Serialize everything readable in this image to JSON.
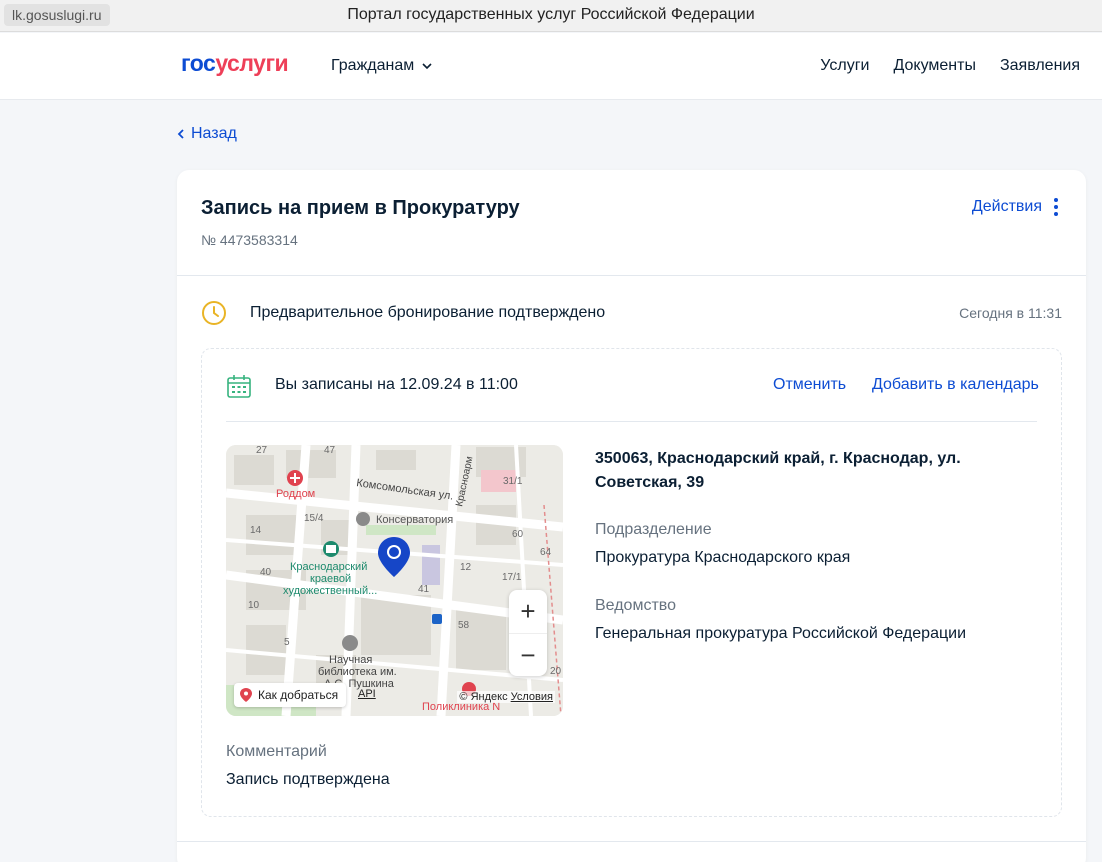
{
  "browser": {
    "url": "lk.gosuslugi.ru",
    "title": "Портал государственных услуг Российской Федерации"
  },
  "header": {
    "logo_part1": "гос",
    "logo_part2": "услуги",
    "citizens_label": "Гражданам",
    "nav": [
      "Услуги",
      "Документы",
      "Заявления"
    ]
  },
  "back_label": "Назад",
  "card": {
    "title": "Запись на прием в Прокуратуру",
    "number": "№ 4473583314",
    "actions_label": "Действия",
    "status_text": "Предварительное бронирование подтверждено",
    "status_time": "Сегодня в 11:31",
    "booked_text": "Вы записаны на 12.09.24 в 11:00",
    "cancel_label": "Отменить",
    "add_calendar_label": "Добавить в календарь",
    "address": "350063, Краснодарский край, г. Краснодар, ул. Советская, 39",
    "department_label": "Подразделение",
    "department_value": "Прокуратура Краснодарского края",
    "agency_label": "Ведомство",
    "agency_value": "Генеральная прокуратура Российской Федерации",
    "comment_label": "Комментарий",
    "comment_value": "Запись подтверждена"
  },
  "map": {
    "labels": {
      "roddom": "Роддом",
      "komsomolskaya": "Комсомольская ул.",
      "krasnoarm": "Красноарм",
      "conservatory": "Консерватория",
      "museum1": "Краснодарский",
      "museum2": "краевой",
      "museum3": "художественный...",
      "library1": "Научная",
      "library2": "библиотека им.",
      "library3": "А.С. Пушкина",
      "clinic": "Поликлиника N",
      "n15_4": "15/4",
      "n14": "14",
      "n40": "40",
      "n10": "10",
      "n5": "5",
      "n47": "47",
      "n27": "27",
      "n31_1": "31/1",
      "n60": "60",
      "n64": "64",
      "n12": "12",
      "n17_1": "17/1",
      "n41": "41",
      "n58": "58",
      "n20": "20"
    },
    "zoom_in": "+",
    "zoom_out": "−",
    "route_label": "Как добраться",
    "api_label": "API",
    "copyright": "© Яндекс",
    "terms_label": "Условия"
  },
  "colors": {
    "brand_blue": "#0d4cd3",
    "brand_red": "#ee3f58",
    "status_yellow": "#e9b426",
    "calendar_green": "#36b37e",
    "pin_blue": "#1646c7"
  }
}
